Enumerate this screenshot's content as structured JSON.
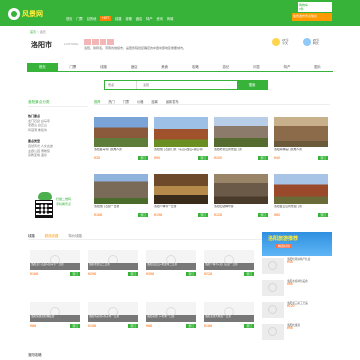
{
  "topbar": {
    "logo_text": "风景网",
    "nav": [
      "首页",
      "门票",
      "目的地",
      "线路",
      "攻略",
      "酒店",
      "特产",
      "资讯",
      "商城"
    ],
    "hot_tag": "HOT",
    "cart_title": "购物车",
    "cart_sub": "0件",
    "promo": "免费发布景点信息"
  },
  "header": {
    "breadcrumb_home": "首页",
    "breadcrumb_sep": ">",
    "breadcrumb_city": "洛阳",
    "city_name": "洛阳市",
    "city_sub": "LUOYANG",
    "desc": "洛阳，简称洛，河南省地级市，是国务院批复确定的中国中部地区重要城市。",
    "weather": [
      {
        "label": "今天",
        "temp": "23℃"
      },
      {
        "label": "明天",
        "temp": "25℃"
      }
    ]
  },
  "tabs": [
    "首页",
    "门票",
    "线路",
    "酒店",
    "美食",
    "攻略",
    "游记",
    "问答",
    "特产",
    "图片"
  ],
  "search": {
    "select_value": "景点",
    "placeholder": "洛阳",
    "button": "搜索"
  },
  "sidebar": {
    "title": "洛阳景点分类",
    "groups": [
      {
        "head": "热门景点",
        "rows": [
          "龙门石窟  白马寺",
          "老君山  白云山",
          "鸡冠洞  重渡沟"
        ]
      },
      {
        "head": "景点类型",
        "rows": [
          "自然风光  人文古迹",
          "主题公园  博物馆",
          "宗教圣地  温泉"
        ]
      }
    ],
    "qr_text_1": "扫描二维码",
    "qr_text_2": "手机看景点"
  },
  "main": {
    "filters": [
      "推荐",
      "热门",
      "门票",
      "价格",
      "距离",
      "最新发布"
    ],
    "cards": [
      {
        "name": "洛阳白马寺门票成人票",
        "price": "¥35",
        "buy": "预订"
      },
      {
        "name": "洛阳龙门石窟门票（东山+西山+香山寺）",
        "price": "¥90",
        "buy": "预订"
      },
      {
        "name": "洛阳老君山风景区门票",
        "price": "¥100",
        "buy": "预订"
      },
      {
        "name": "洛阳关林庙门票成人票",
        "price": "¥40",
        "buy": "预订"
      },
      {
        "name": "洛阳龙门石窟一日游",
        "price": "¥168",
        "buy": "预订"
      },
      {
        "name": "洛阳少林寺一日游",
        "price": "¥198",
        "buy": "预订"
      },
      {
        "name": "洛阳石窟精华游",
        "price": "¥128",
        "buy": "预订"
      },
      {
        "name": "洛阳白云山风景区门票",
        "price": "¥80",
        "buy": "预订"
      }
    ]
  },
  "lower": {
    "title": "线路",
    "tab1": "精选线路",
    "tab2": "特价线路",
    "more": "更多",
    "cards": [
      {
        "name": "洛阳龙门石窟+白马寺一日游",
        "price": "¥168",
        "buy": "预订"
      },
      {
        "name": "洛阳老君山二日游",
        "price": "¥298",
        "buy": "预订"
      },
      {
        "name": "洛阳白云山+重渡沟二日游",
        "price": "¥398",
        "buy": "预订"
      },
      {
        "name": "洛阳少林寺+龙门石窟一日游",
        "price": "¥228",
        "buy": "预订"
      },
      {
        "name": "洛阳隋唐洛阳城夜游",
        "price": "¥88",
        "buy": "预订"
      },
      {
        "name": "洛阳鸡冠洞+养子沟一日游",
        "price": "¥158",
        "buy": "预订"
      },
      {
        "name": "洛阳丽景门+老城一日游",
        "price": "¥68",
        "buy": "预订"
      },
      {
        "name": "洛阳龙潭大峡谷一日游",
        "price": "¥188",
        "buy": "预订"
      }
    ]
  },
  "ad": {
    "banner_title": "洛阳旅游推荐",
    "banner_sub": "精选好货",
    "items": [
      {
        "name": "洛阳牡丹饼特产礼盒",
        "price": "¥45"
      },
      {
        "name": "洛阳水席特色美食",
        "price": "¥58"
      },
      {
        "name": "洛阳唐三彩工艺品",
        "price": "¥120"
      },
      {
        "name": "洛阳杜康酒",
        "price": "¥98"
      }
    ]
  },
  "footer_title": "洛阳攻略",
  "colors": {
    "brand": "#37b339",
    "price": "#ff6600",
    "hot": "#ff7f00"
  }
}
